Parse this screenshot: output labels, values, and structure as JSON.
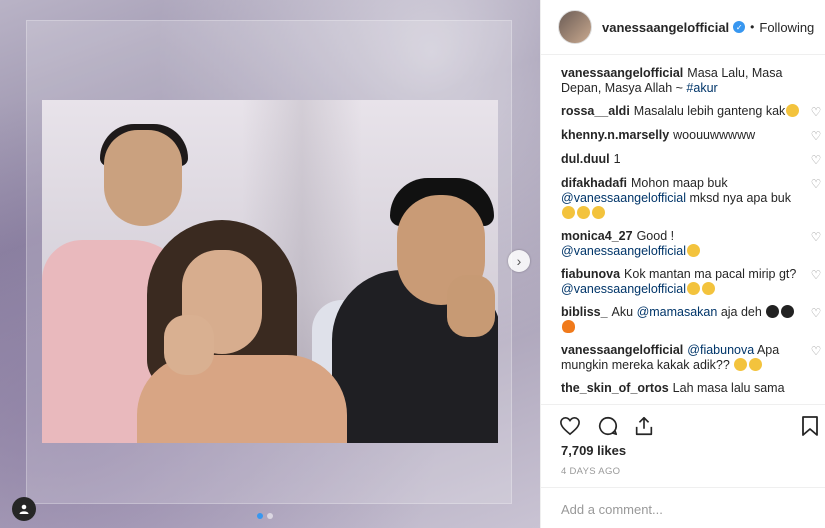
{
  "post": {
    "username": "vanessaangelofficial",
    "separator": "•",
    "follow_status": "Following",
    "likes": "7,709 likes",
    "date": "4 DAYS AGO",
    "comment_placeholder": "Add a comment..."
  },
  "comments": [
    {
      "user": "vanessaangelofficial",
      "text": "Masa Lalu, Masa Depan, Masya Allah ~ ",
      "mention": "#akur",
      "after": "",
      "emojis": [],
      "heart": false
    },
    {
      "user": "rossa__aldi",
      "text": "Masalalu lebih ganteng kak",
      "mention": "",
      "after": "",
      "emojis": [
        "laugh"
      ],
      "heart": true
    },
    {
      "user": "khenny.n.marselly",
      "text": "woouuwwwww",
      "mention": "",
      "after": "",
      "emojis": [],
      "heart": true
    },
    {
      "user": "dul.duul",
      "text": "1",
      "mention": "",
      "after": "",
      "emojis": [],
      "heart": true
    },
    {
      "user": "difakhadafi",
      "text": "Mohon maap buk ",
      "mention": "@vanessaangelofficial",
      "after": " mksd nya apa buk ",
      "emojis": [
        "laugh",
        "laugh",
        "laugh"
      ],
      "heart": true
    },
    {
      "user": "monica4_27",
      "text": "Good ! ",
      "mention": "@vanessaangelofficial",
      "after": "",
      "emojis": [
        "smile"
      ],
      "heart": true
    },
    {
      "user": "fiabunova",
      "text": "Kok mantan ma pacal mirip gt? ",
      "mention": "@vanessaangelofficial",
      "after": "",
      "emojis": [
        "laugh",
        "laugh"
      ],
      "heart": true
    },
    {
      "user": "bibliss_",
      "text": "Aku ",
      "mention": "@mamasakan",
      "after": " aja deh ",
      "emojis": [
        "eyes",
        "eyes",
        "fire"
      ],
      "heart": true
    },
    {
      "user": "vanessaangelofficial",
      "text": "",
      "mention": "@fiabunova",
      "after": " Apa mungkin mereka kakak adik?? ",
      "emojis": [
        "scream",
        "scream"
      ],
      "heart": true
    },
    {
      "user": "the_skin_of_ortos",
      "text": "Lah masa lalu sama",
      "mention": "",
      "after": "",
      "emojis": [],
      "heart": false
    }
  ],
  "icons": {
    "next": "chevron-right-icon",
    "tag": "user-tag-icon",
    "like": "heart-icon",
    "comment": "comment-icon",
    "share": "share-icon",
    "save": "bookmark-icon",
    "verified": "verified-badge-icon"
  },
  "colors": {
    "accent": "#3897f0",
    "mention": "#003569"
  }
}
